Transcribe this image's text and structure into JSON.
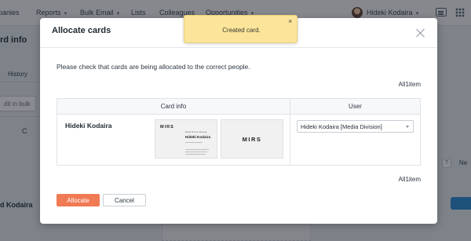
{
  "background": {
    "nav": [
      "panies",
      "Reports",
      "Bulk Email",
      "Lists",
      "Colleagues",
      "Opportunities"
    ],
    "user_name": "Hideki Kodaira",
    "left": {
      "title": "rd info",
      "tab": "History",
      "bulk_button": "dit in bulk",
      "letter": "C",
      "name": "d Kodaira"
    },
    "right": {
      "small_button": "?",
      "text": "Ne"
    }
  },
  "modal": {
    "title": "Allocate cards",
    "instruction": "Please check that cards are being allocated to the correct people.",
    "count": "All1item",
    "table": {
      "headers": [
        "Card info",
        "User"
      ],
      "rows": [
        {
          "name": "Hideki Kodaira",
          "card_front": {
            "logo": "MIRS",
            "title": "Media Division Manager",
            "name": "Hideki Kodaira"
          },
          "card_back": {
            "logo": "MIRS"
          },
          "user": "Hideki Kodaira [Media Division]"
        }
      ]
    },
    "count_bottom": "All1item",
    "allocate_label": "Allocate",
    "cancel_label": "Cancel"
  },
  "toast": {
    "message": "Created card.",
    "close_symbol": "×"
  },
  "colors": {
    "primary": "#f07a54",
    "toast": "#fbe59a",
    "overlay": "rgba(10,15,25,0.48)"
  }
}
